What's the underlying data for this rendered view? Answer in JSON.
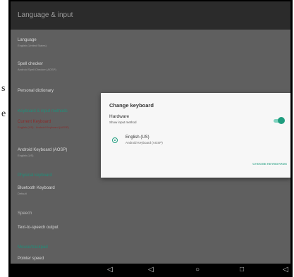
{
  "edge_fragments": [
    "s",
    "e"
  ],
  "appbar": {
    "title": "Language & input"
  },
  "settings": [
    {
      "title": "Language",
      "subtitle": "English (United States)"
    },
    {
      "title": "Spell checker",
      "subtitle": "Android Spell Checker (AOSP)"
    },
    {
      "title": "Personal dictionary",
      "subtitle": ""
    },
    {
      "title": "Keyboard & input methods",
      "subtitle": ""
    },
    {
      "title": "Current Keyboard",
      "subtitle": "English (US) - Android Keyboard (AOSP)"
    },
    {
      "title": "Android Keyboard (AOSP)",
      "subtitle": "English (US)"
    },
    {
      "title": "Physical keyboard",
      "subtitle": ""
    },
    {
      "title": "Bluetooth Keyboard",
      "subtitle": "Default"
    },
    {
      "title": "Speech",
      "subtitle": ""
    },
    {
      "title": "Text-to-speech output",
      "subtitle": ""
    },
    {
      "title": "Mouse/trackpad",
      "subtitle": ""
    },
    {
      "title": "Pointer speed",
      "subtitle": ""
    }
  ],
  "dialog": {
    "title": "Change keyboard",
    "section": "Hardware",
    "section_sub": "Show input method",
    "toggle_on": true,
    "keyboard_name": "English (US)",
    "keyboard_sub": "Android Keyboard (AOSP)",
    "link": "CHOOSE KEYBOARDS"
  },
  "navbar": {
    "icons": [
      "volume-down-icon",
      "back-icon",
      "home-icon",
      "recents-icon",
      "volume-up-icon"
    ],
    "glyphs": [
      "◁",
      "◁",
      "○",
      "□",
      "◁"
    ]
  },
  "colors": {
    "accent": "#1f9d7f",
    "appbar": "#2b2b2b",
    "dimmed_bg": "#5f5f5f"
  }
}
